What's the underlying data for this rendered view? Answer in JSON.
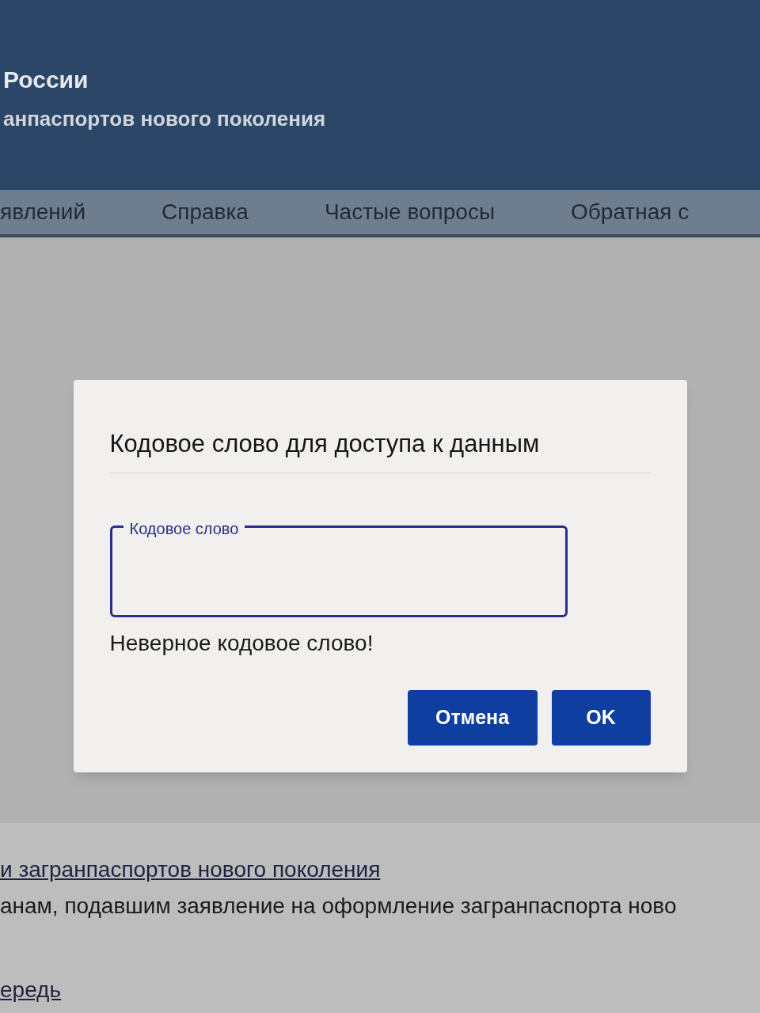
{
  "header": {
    "title": "России",
    "subtitle": "анпаспортов нового поколения"
  },
  "nav": [
    {
      "label": "явлений"
    },
    {
      "label": "Справка"
    },
    {
      "label": "Частые вопросы"
    },
    {
      "label": "Обратная с"
    }
  ],
  "dialog": {
    "title": "Кодовое слово для доступа к данным",
    "field": {
      "label": "Кодовое слово"
    },
    "error": "Неверное кодовое слово!",
    "buttons": [
      {
        "label": "Отмена"
      },
      {
        "label": "OK"
      }
    ]
  },
  "content": {
    "link": "и загранпаспортов нового поколения",
    "text": "анам, подавшим заявление на оформление загранпаспорта ново",
    "link_2": "ередь"
  }
}
